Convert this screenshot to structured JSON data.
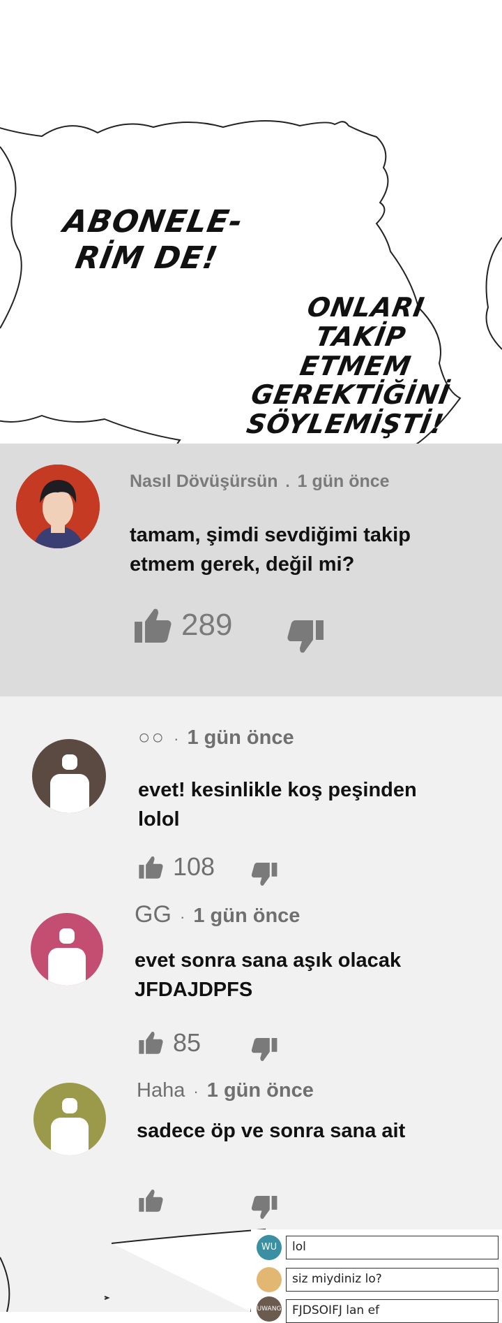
{
  "bubble": {
    "left_text": [
      "ABONELE-",
      "RİM DE!"
    ],
    "right_text": [
      "ONLARI",
      "TAKİP ETMEM",
      "GEREKTİĞİNİ",
      "SÖYLEMİŞTİ!"
    ]
  },
  "comments": [
    {
      "author": "Nasıl Dövüşürsün",
      "time": "1 gün önce",
      "text_lines": [
        "tamam, şimdi sevdiğimi takip",
        "etmem gerek, değil mi?"
      ],
      "likes": "289"
    },
    {
      "author": "○○",
      "time": "1 gün önce",
      "text_lines": [
        "evet! kesinlikle koş peşinden",
        "lolol"
      ],
      "likes": "108",
      "avatar_color": "#5b4a42"
    },
    {
      "author": "GG",
      "time": "1 gün önce",
      "text_lines": [
        "evet sonra sana aşık olacak",
        "JFDAJDPFS"
      ],
      "likes": "85",
      "avatar_color": "#c44d72"
    },
    {
      "author": "Haha",
      "time": "1 gün önce",
      "text_lines": [
        "sadece öp ve sonra sana ait"
      ],
      "likes": "",
      "avatar_color": "#9a9a4a"
    }
  ],
  "chat": [
    {
      "avatar": "WU",
      "text": "lol",
      "color": "#3a8fa3"
    },
    {
      "avatar": "",
      "text": "siz miydiniz lo?",
      "color": "#e1b772"
    },
    {
      "avatar": "UWANG",
      "text": "FJDSOIFJ lan ef",
      "color": "#6b5a4e"
    }
  ],
  "colors": {
    "top_panel": "#dcdcdc",
    "bottom_panel": "#f1f1f1",
    "meta_gray": "#6f6f6f"
  },
  "icons": [
    "thumbs-up-icon",
    "thumbs-down-icon",
    "default-avatar-icon"
  ]
}
